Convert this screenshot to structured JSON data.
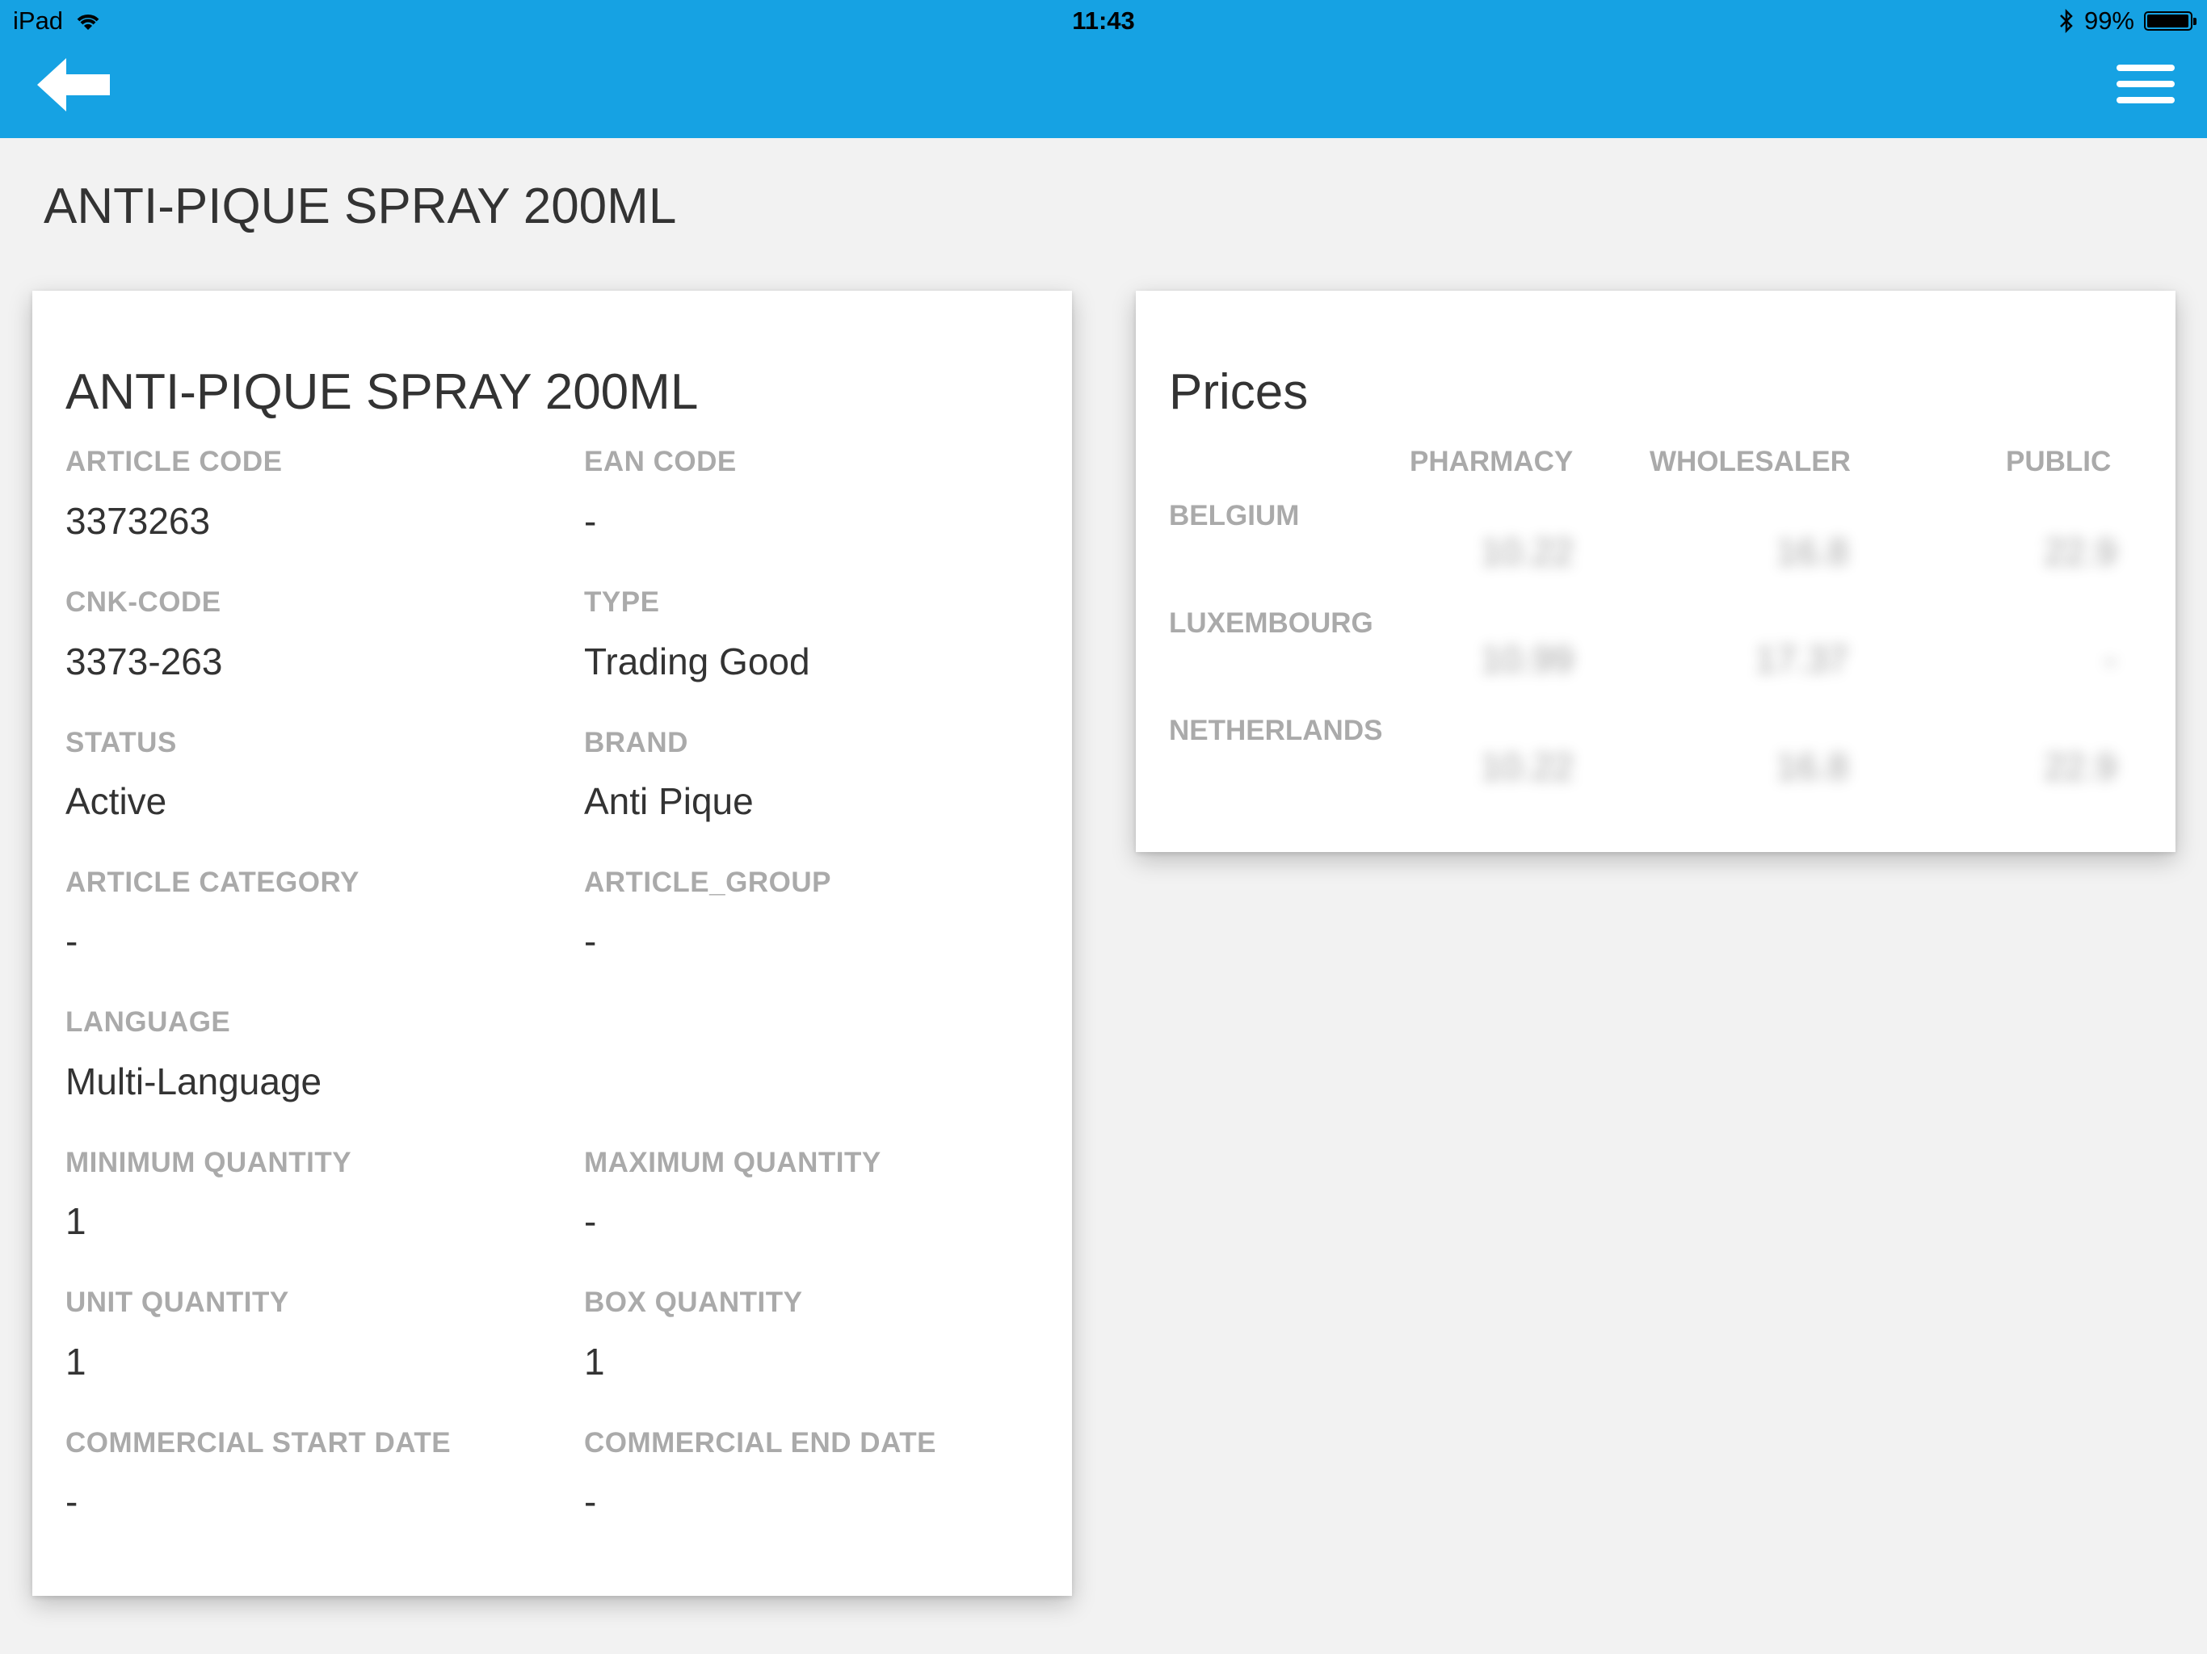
{
  "status_bar": {
    "device": "iPad",
    "time": "11:43",
    "battery": "99%"
  },
  "nav": {
    "back_icon": "arrow-left-icon",
    "menu_icon": "hamburger-menu-icon"
  },
  "page": {
    "title": "ANTI-PIQUE SPRAY 200ML"
  },
  "details": {
    "title": "ANTI-PIQUE SPRAY 200ML",
    "fields": {
      "article_code": {
        "label": "ARTICLE CODE",
        "value": "3373263"
      },
      "ean_code": {
        "label": "EAN CODE",
        "value": "-"
      },
      "cnk_code": {
        "label": "CNK-CODE",
        "value": "3373-263"
      },
      "type": {
        "label": "TYPE",
        "value": "Trading Good"
      },
      "status": {
        "label": "STATUS",
        "value": "Active"
      },
      "brand": {
        "label": "BRAND",
        "value": "Anti Pique"
      },
      "article_category": {
        "label": "ARTICLE CATEGORY",
        "value": "-"
      },
      "article_group": {
        "label": "ARTICLE_GROUP",
        "value": "-"
      },
      "language": {
        "label": "LANGUAGE",
        "value": "Multi-Language"
      },
      "minimum_quantity": {
        "label": "MINIMUM QUANTITY",
        "value": "1"
      },
      "maximum_quantity": {
        "label": "MAXIMUM QUANTITY",
        "value": "-"
      },
      "unit_quantity": {
        "label": "UNIT QUANTITY",
        "value": "1"
      },
      "box_quantity": {
        "label": "BOX QUANTITY",
        "value": "1"
      },
      "commercial_start_date": {
        "label": "COMMERCIAL START DATE",
        "value": "-"
      },
      "commercial_end_date": {
        "label": "COMMERCIAL END DATE",
        "value": "-"
      }
    }
  },
  "prices": {
    "title": "Prices",
    "columns": [
      "PHARMACY",
      "WHOLESALER",
      "PUBLIC"
    ],
    "rows": [
      {
        "country": "BELGIUM",
        "pharmacy": "10.22",
        "wholesaler": "16.8",
        "public": "22.9"
      },
      {
        "country": "LUXEMBOURG",
        "pharmacy": "10.99",
        "wholesaler": "17.37",
        "public": "-"
      },
      {
        "country": "NETHERLANDS",
        "pharmacy": "10.22",
        "wholesaler": "16.8",
        "public": "22.9"
      }
    ]
  }
}
